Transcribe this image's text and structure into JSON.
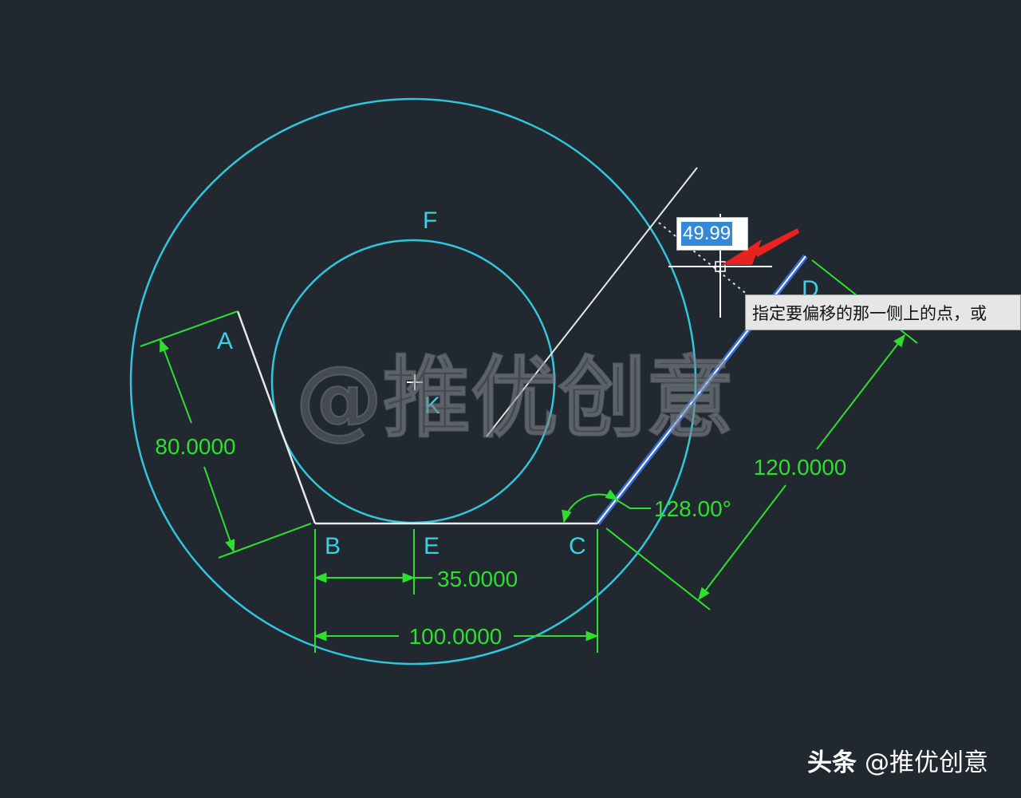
{
  "drawing": {
    "points": {
      "A": "A",
      "B": "B",
      "C": "C",
      "D": "D",
      "E": "E",
      "F": "F",
      "K": "K"
    },
    "dimensions": {
      "left_side": "80.0000",
      "be": "35.0000",
      "bc": "100.0000",
      "cd": "120.0000",
      "angle": "128.00°"
    },
    "colors": {
      "background": "#212830",
      "circles": "#32c6dc",
      "geometry": "#e8e8e8",
      "dimensions": "#2ee02e",
      "highlight": "#3a7bff",
      "arrow": "#e8221e"
    }
  },
  "command": {
    "dynamic_input_value": "49.99",
    "prompt": "指定要偏移的那一侧上的点，或"
  },
  "watermark": {
    "overlay": "@推优创意",
    "brand_prefix": "头条",
    "brand_name": "@推优创意"
  }
}
